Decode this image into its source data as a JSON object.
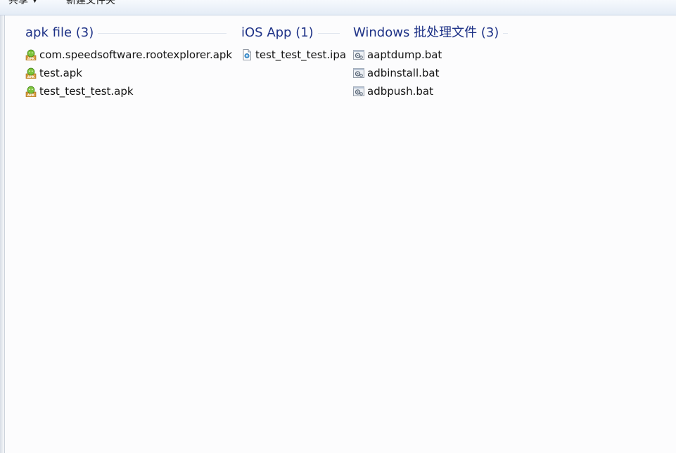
{
  "toolbar": {
    "share_label": "共享",
    "new_folder_label": "新建文件夹"
  },
  "groups": [
    {
      "title": "apk file (3)",
      "icon": "android-apk-icon",
      "items": [
        {
          "name": "com.speedsoftware.rootexplorer.apk"
        },
        {
          "name": "test.apk"
        },
        {
          "name": "test_test_test.apk"
        }
      ]
    },
    {
      "title": "iOS App (1)",
      "icon": "ios-ipa-icon",
      "items": [
        {
          "name": "test_test_test.ipa"
        }
      ]
    },
    {
      "title": "Windows 批处理文件 (3)",
      "icon": "batch-file-icon",
      "items": [
        {
          "name": "aaptdump.bat"
        },
        {
          "name": "adbinstall.bat"
        },
        {
          "name": "adbpush.bat"
        }
      ]
    }
  ],
  "colors": {
    "group_title": "#1e3287",
    "separator": "#dfe5ee",
    "text": "#141414"
  }
}
